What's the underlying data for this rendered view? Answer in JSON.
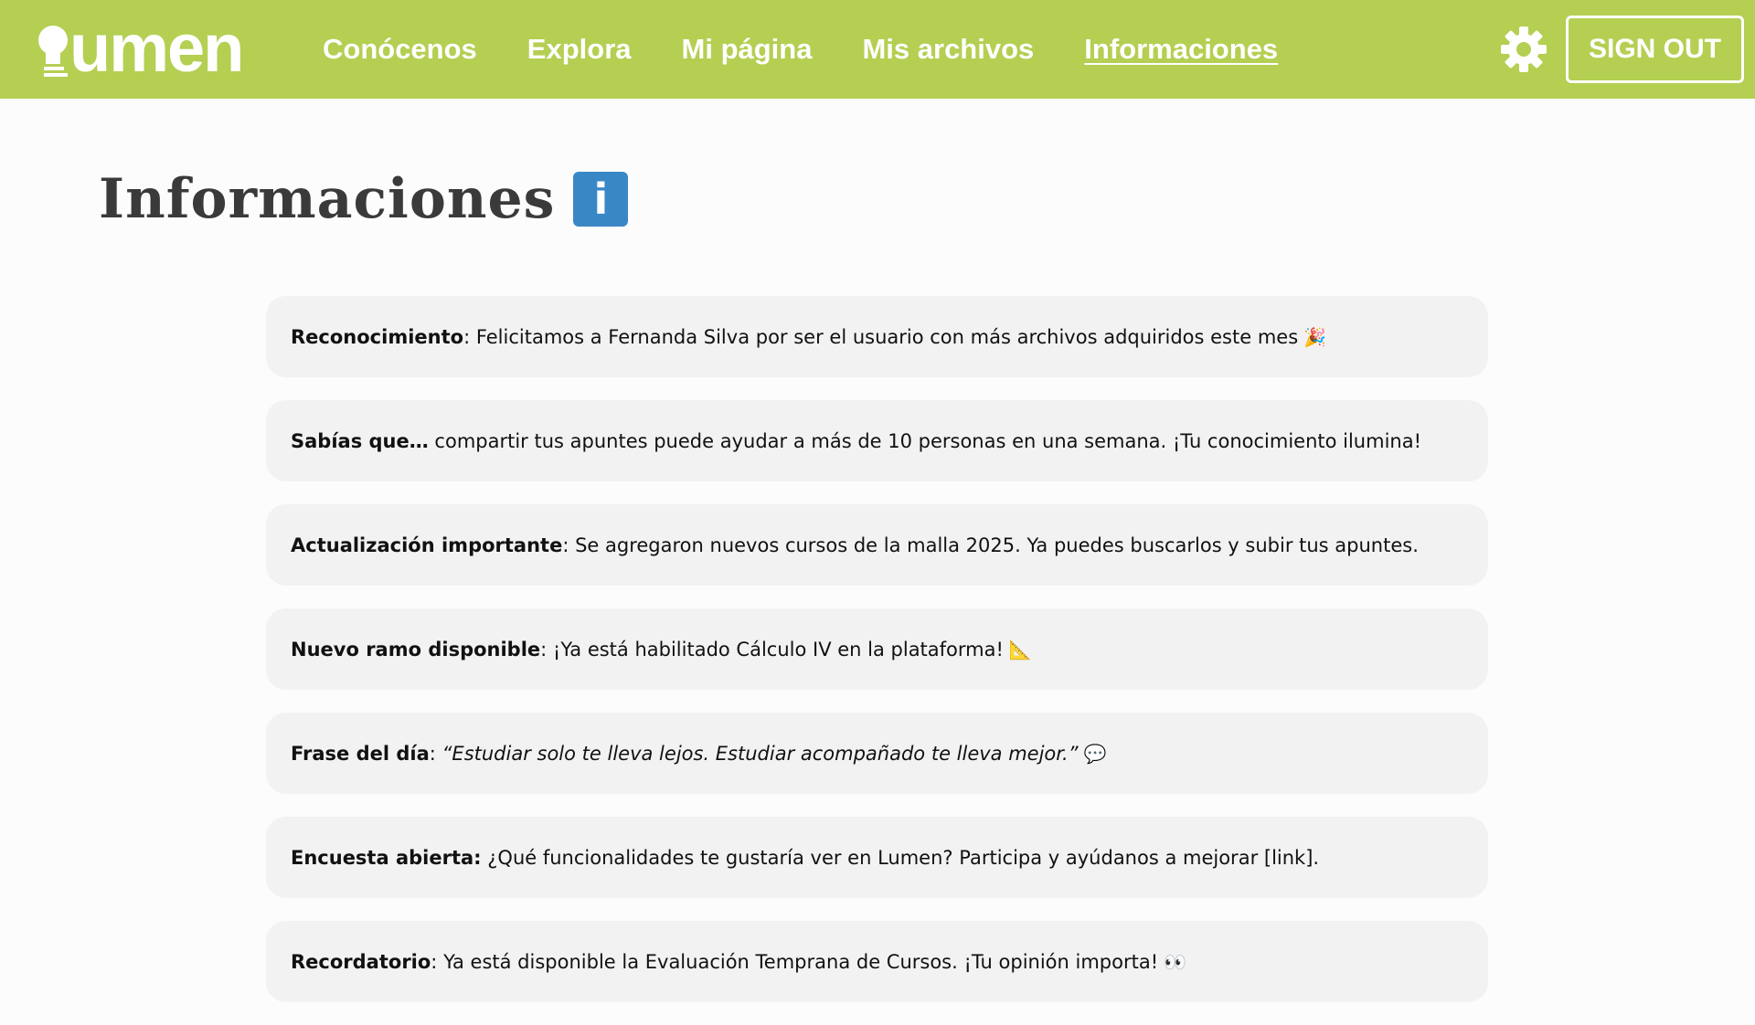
{
  "app": {
    "logo_text": "umen",
    "brand_color": "#b4cf52",
    "accent_color": "#3a87c6"
  },
  "nav": {
    "links": [
      {
        "label": "Conócenos",
        "active": false
      },
      {
        "label": "Explora",
        "active": false
      },
      {
        "label": "Mi página",
        "active": false
      },
      {
        "label": "Mis archivos",
        "active": false
      },
      {
        "label": "Informaciones",
        "active": true
      }
    ],
    "settings_icon": "gear-icon",
    "signout_label": "SIGN OUT"
  },
  "page": {
    "title": "Informaciones",
    "title_badge": "i",
    "title_icon": "info-icon"
  },
  "announcements": [
    {
      "label": "Reconocimiento",
      "sep": ": ",
      "text": "Felicitamos a Fernanda Silva por ser el usuario con más archivos adquiridos este mes",
      "emoji": "🎉",
      "italic": false
    },
    {
      "label": "Sabías que…",
      "sep": " ",
      "text": "compartir tus apuntes puede ayudar a más de 10 personas en una semana. ¡Tu conocimiento ilumina!",
      "emoji": "",
      "italic": false
    },
    {
      "label": "Actualización importante",
      "sep": ": ",
      "text": "Se agregaron nuevos cursos de la malla 2025. Ya puedes buscarlos y subir tus apuntes.",
      "emoji": "",
      "italic": false
    },
    {
      "label": "Nuevo ramo disponible",
      "sep": ": ",
      "text": "¡Ya está habilitado Cálculo IV en la plataforma!",
      "emoji": "📐",
      "italic": false
    },
    {
      "label": "Frase del día",
      "sep": ": ",
      "text": "“Estudiar solo te lleva lejos. Estudiar acompañado te lleva mejor.”",
      "emoji": "💬",
      "italic": true
    },
    {
      "label": "Encuesta abierta:",
      "sep": " ",
      "text": "¿Qué funcionalidades te gustaría ver en Lumen? Participa y ayúdanos a mejorar [link].",
      "emoji": "",
      "italic": false
    },
    {
      "label": "Recordatorio",
      "sep": ": ",
      "text": "Ya está disponible la Evaluación Temprana de Cursos. ¡Tu opinión importa!",
      "emoji": "👀",
      "italic": false
    }
  ]
}
